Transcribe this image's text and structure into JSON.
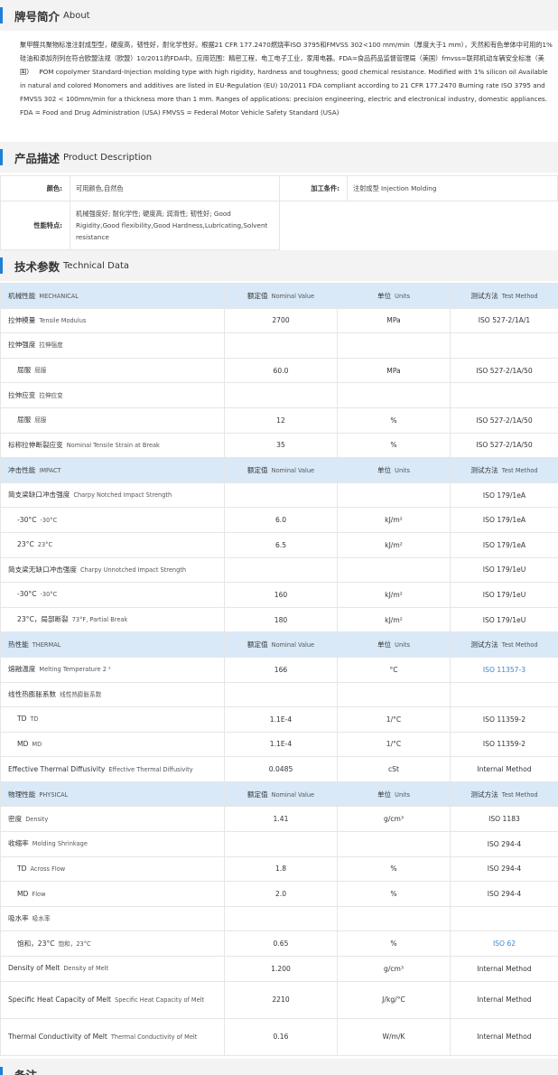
{
  "about": {
    "title_cn": "牌号简介",
    "title_en": "About",
    "text_cn": "聚甲醛共聚物标准注射成型型，硬度高，韧性好，耐化学性好。根据21 CFR 177.2470燃烧率ISO 3795和FMVSS 302<100 mm/min（厚度大于1 mm），天然和有色单体中可用的1%硅油和添加剂列在符合欧盟法规（欧盟）10/2011的FDA中。应用范围：精密工程，电工电子工业，家用电器。FDA=食品药品监督管理局（美国）fmvss=联邦机动车辆安全标准（美国）",
    "text_en": "POM copolymer Standard-Injection molding type with high rigidity, hardness and toughness; good chemical resistance. Modified with 1% silicon oil Available in natural and colored Monomers and additives are listed in EU-Regulation (EU) 10/2011 FDA compliant according to 21 CFR 177.2470 Burning rate ISO 3795 and FMVSS 302 < 100mm/min for a thickness more than 1 mm. Ranges of applications: precision engineering, electric and electronical industry, domestic appliances. FDA = Food and Drug Administration (USA) FMVSS = Federal Motor Vehicle Safety Standard (USA)"
  },
  "description": {
    "title_cn": "产品描述",
    "title_en": "Product Description",
    "color_label": "颜色:",
    "color_value": "可用颜色,自然色",
    "process_label": "加工条件:",
    "process_value": "注射成型  Injection Molding",
    "features_label": "性能特点:",
    "features_value": "机械强度好; 耐化学性; 硬度高; 润滑性; 韧性好;   Good Rigidity,Good flexibility,Good Hardness,Lubricating,Solvent resistance"
  },
  "tech": {
    "title_cn": "技术参数",
    "title_en": "Technical Data",
    "rows": [
      {
        "type": "header",
        "name": "机械性能",
        "name_en": "MECHANICAL",
        "value": "额定值",
        "value_en": "Nominal Value",
        "unit": "单位",
        "unit_en": "Units",
        "method": "测试方法",
        "method_en": "Test Method"
      },
      {
        "type": "row",
        "name": "拉伸模量",
        "name_en": "Tensile Modulus",
        "value": "2700",
        "unit": "MPa",
        "method": "ISO 527-2/1A/1"
      },
      {
        "type": "row",
        "name": "拉伸强度",
        "name_en": "拉伸强度",
        "value": "",
        "unit": "",
        "method": ""
      },
      {
        "type": "sub",
        "name": "屈服",
        "name_en": "屈服",
        "value": "60.0",
        "unit": "MPa",
        "method": "ISO 527-2/1A/50"
      },
      {
        "type": "row",
        "name": "拉伸应变",
        "name_en": "拉伸应变",
        "value": "",
        "unit": "",
        "method": ""
      },
      {
        "type": "sub",
        "name": "屈服",
        "name_en": "屈服",
        "value": "12",
        "unit": "%",
        "method": "ISO 527-2/1A/50"
      },
      {
        "type": "row",
        "name": "标称拉伸断裂应变",
        "name_en": "Nominal Tensile Strain at Break",
        "value": "35",
        "unit": "%",
        "method": "ISO 527-2/1A/50"
      },
      {
        "type": "header",
        "name": "冲击性能",
        "name_en": "IMPACT",
        "value": "额定值",
        "value_en": "Nominal Value",
        "unit": "单位",
        "unit_en": "Units",
        "method": "测试方法",
        "method_en": "Test Method"
      },
      {
        "type": "row",
        "name": "简支梁缺口冲击强度",
        "name_en": "Charpy Notched Impact Strength",
        "value": "",
        "unit": "",
        "method": "ISO 179/1eA"
      },
      {
        "type": "sub",
        "name": "-30°C",
        "name_en": "-30°C",
        "value": "6.0",
        "unit": "kJ/m²",
        "method": "ISO 179/1eA"
      },
      {
        "type": "sub",
        "name": "23°C",
        "name_en": "23°C",
        "value": "6.5",
        "unit": "kJ/m²",
        "method": "ISO 179/1eA"
      },
      {
        "type": "row",
        "name": "简支梁无缺口冲击强度",
        "name_en": "Charpy Unnotched Impact Strength",
        "value": "",
        "unit": "",
        "method": "ISO 179/1eU"
      },
      {
        "type": "sub",
        "name": "-30°C",
        "name_en": "-30°C",
        "value": "160",
        "unit": "kJ/m²",
        "method": "ISO 179/1eU"
      },
      {
        "type": "sub",
        "name": "23°C，局部断裂",
        "name_en": "73°F, Partial Break",
        "value": "180",
        "unit": "kJ/m²",
        "method": "ISO 179/1eU"
      },
      {
        "type": "header",
        "name": "热性能",
        "name_en": "THERMAL",
        "value": "额定值",
        "value_en": "Nominal Value",
        "unit": "单位",
        "unit_en": "Units",
        "method": "测试方法",
        "method_en": "Test Method"
      },
      {
        "type": "row",
        "name": "熔融温度",
        "name_en": "Melting Temperature  2 ²",
        "value": "166",
        "unit": "°C",
        "method": "ISO 11357-3",
        "link": true
      },
      {
        "type": "row",
        "name": "线性热膨胀系数",
        "name_en": "线性热膨胀系数",
        "value": "",
        "unit": "",
        "method": ""
      },
      {
        "type": "sub",
        "name": "TD",
        "name_en": "TD",
        "value": "1.1E-4",
        "unit": "1/°C",
        "method": "ISO 11359-2"
      },
      {
        "type": "sub",
        "name": "MD",
        "name_en": "MD",
        "value": "1.1E-4",
        "unit": "1/°C",
        "method": "ISO 11359-2"
      },
      {
        "type": "row",
        "name": "Effective Thermal Diffusivity",
        "name_en": "Effective Thermal Diffusivity",
        "value": "0.0485",
        "unit": "cSt",
        "method": "Internal Method"
      },
      {
        "type": "header",
        "name": "物理性能",
        "name_en": "PHYSICAL",
        "value": "额定值",
        "value_en": "Nominal Value",
        "unit": "单位",
        "unit_en": "Units",
        "method": "测试方法",
        "method_en": "Test Method"
      },
      {
        "type": "row",
        "name": "密度",
        "name_en": "Density",
        "value": "1.41",
        "unit": "g/cm³",
        "method": "ISO 1183"
      },
      {
        "type": "row",
        "name": "收缩率",
        "name_en": "Molding Shrinkage",
        "value": "",
        "unit": "",
        "method": "ISO 294-4"
      },
      {
        "type": "sub",
        "name": "TD",
        "name_en": "Across Flow",
        "value": "1.8",
        "unit": "%",
        "method": "ISO 294-4"
      },
      {
        "type": "sub",
        "name": "MD",
        "name_en": "Flow",
        "value": "2.0",
        "unit": "%",
        "method": "ISO 294-4"
      },
      {
        "type": "row",
        "name": "吸水率",
        "name_en": "吸水率",
        "value": "",
        "unit": "",
        "method": ""
      },
      {
        "type": "sub",
        "name": "饱和，23°C",
        "name_en": "饱和，23°C",
        "value": "0.65",
        "unit": "%",
        "method": "ISO 62",
        "link": true
      },
      {
        "type": "row",
        "name": "Density of Melt",
        "name_en": "Density of Melt",
        "value": "1.200",
        "unit": "g/cm³",
        "method": "Internal Method"
      },
      {
        "type": "row2",
        "name": "Specific Heat Capacity of Melt",
        "name_en": "Specific Heat Capacity of Melt",
        "value": "2210",
        "unit": "J/kg/°C",
        "method": "Internal Method"
      },
      {
        "type": "row2",
        "name": "Thermal Conductivity of Melt",
        "name_en": "Thermal Conductivity of Melt",
        "value": "0.16",
        "unit": "W/m/K",
        "method": "Internal Method"
      }
    ]
  },
  "notes": {
    "title_cn": "备注"
  },
  "colors": {
    "accent": "#1e7fd6",
    "header_row_bg": "#d9e9f8",
    "section_bg": "#f3f3f3",
    "link": "#3a85d4"
  }
}
